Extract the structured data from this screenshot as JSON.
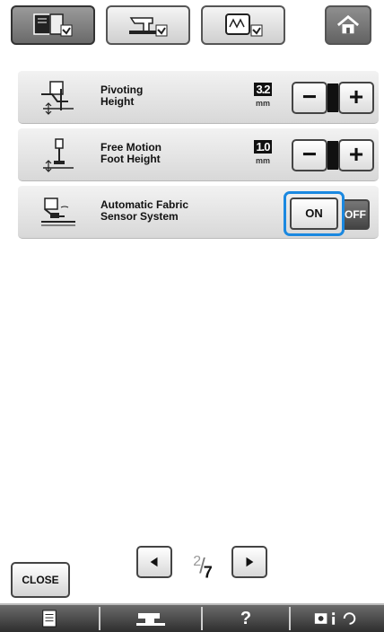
{
  "tabs": [
    {
      "icon": "utility-book-icon",
      "active": true
    },
    {
      "icon": "sewing-machine-settings-icon",
      "active": false
    },
    {
      "icon": "embroidery-frame-icon",
      "active": false
    }
  ],
  "home": {
    "icon": "home-icon"
  },
  "settings": [
    {
      "label_line1": "Pivoting",
      "label_line2": "Height",
      "value": "3.2",
      "unit": "mm",
      "icon": "presser-foot-pivot-icon"
    },
    {
      "label_line1": "Free Motion",
      "label_line2": "Foot Height",
      "value": "1.0",
      "unit": "mm",
      "icon": "free-motion-foot-icon"
    },
    {
      "label_line1": "Automatic Fabric",
      "label_line2": "Sensor System",
      "on_label": "ON",
      "off_label": "OFF",
      "state": "on",
      "icon": "fabric-sensor-icon"
    }
  ],
  "stepper": {
    "minus": "−",
    "plus": "+"
  },
  "pager": {
    "current": "2",
    "total": "7",
    "prev_icon": "left-triangle-icon",
    "next_icon": "right-triangle-icon"
  },
  "close_label": "CLOSE",
  "bottombar": {
    "items": [
      "document-icon",
      "machine-icon",
      "?",
      "camera-info-icon"
    ]
  },
  "colors": {
    "highlight": "#1a88e0",
    "row_bg": "#e4e4e4",
    "bar_bg": "#3e3e3e"
  }
}
